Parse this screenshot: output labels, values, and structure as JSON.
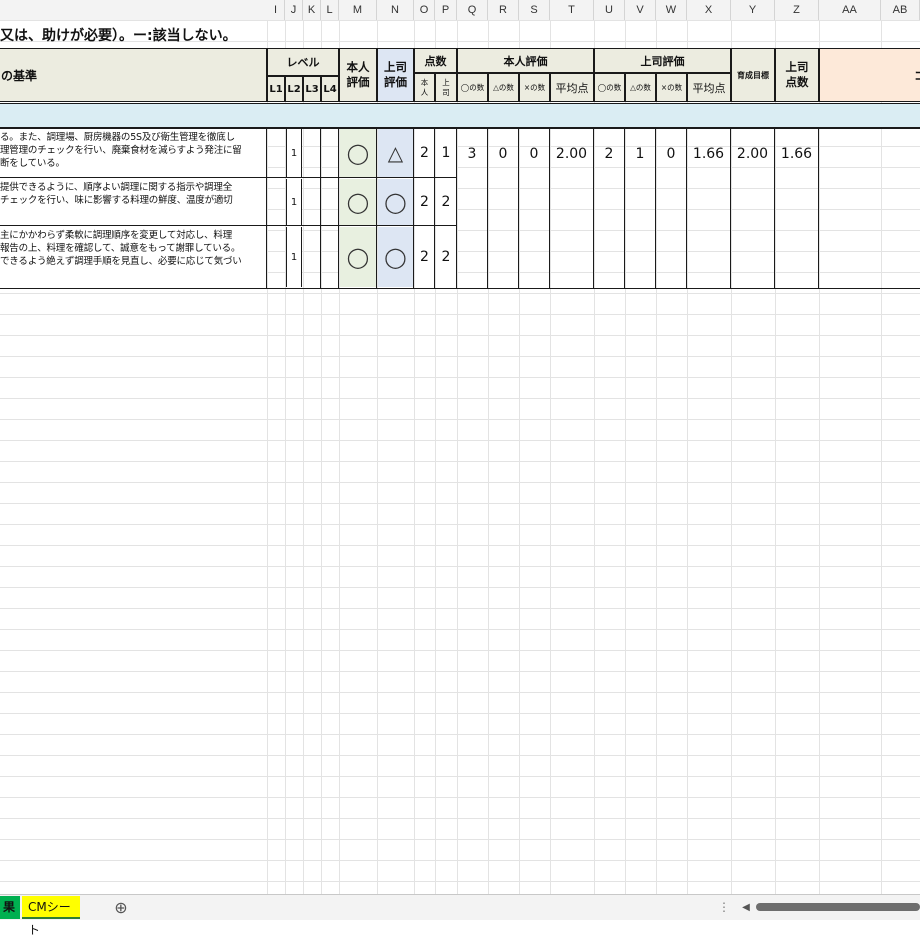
{
  "column_headers": [
    "I",
    "J",
    "K",
    "L",
    "M",
    "N",
    "O",
    "P",
    "Q",
    "R",
    "S",
    "T",
    "U",
    "V",
    "W",
    "X",
    "Y",
    "Z",
    "AA",
    "AB"
  ],
  "title_text": "又は、助けが必要）。ー:該当しない。",
  "headers": {
    "criteria": "の基準",
    "level": "レベル",
    "level_cols": [
      "L1",
      "L2",
      "L3",
      "L4"
    ],
    "self_eval": "本人評価",
    "boss_eval": "上司評価",
    "points": "点数",
    "points_self": "本人",
    "points_boss": "上司",
    "self_eval_group": "本人評価",
    "boss_eval_group": "上司評価",
    "circle_count": "◯の数",
    "triangle_count": "△の数",
    "cross_count": "×の数",
    "average": "平均点",
    "goal": "育成目標",
    "boss_points": "上司点数",
    "comment": "コ"
  },
  "rows": [
    {
      "criteria": "る。また、調理場、厨房機器の5S及び衛生管理を徹底し\n理管理のチェックを行い、廃棄食材を減らすよう発注に留\n断をしている。",
      "level": "1",
      "self_mark": "◯",
      "boss_mark": "△",
      "self_pt": "2",
      "boss_pt": "1"
    },
    {
      "criteria": "提供できるように、順序よい調理に関する指示や調理全\nチェックを行い、味に影響する料理の鮮度、温度が適切",
      "level": "1",
      "self_mark": "◯",
      "boss_mark": "◯",
      "self_pt": "2",
      "boss_pt": "2"
    },
    {
      "criteria": "主にかかわらず柔軟に調理順序を変更して対応し、料理\n報告の上、料理を確認して、誠意をもって謝罪している。\nできるよう絶えず調理手順を見直し、必要に応じて気づい",
      "level": "1",
      "self_mark": "◯",
      "boss_mark": "◯",
      "self_pt": "2",
      "boss_pt": "2"
    }
  ],
  "summary": {
    "self_circle": "3",
    "self_triangle": "0",
    "self_cross": "0",
    "self_avg": "2.00",
    "boss_circle": "2",
    "boss_triangle": "1",
    "boss_cross": "0",
    "boss_avg": "1.66",
    "goal": "2.00",
    "boss_points": "1.66"
  },
  "tabs": {
    "prev_tab": "果",
    "active_tab": "CMシート",
    "add_sheet": "⊕",
    "more": "⋮",
    "scroll_left": "◀"
  },
  "colors": {
    "header_bg": "#ecece0",
    "band_bg": "#daedf3",
    "self_col_bg": "#e8f0e0",
    "boss_col_bg": "#dde6f3",
    "comment_bg": "#fde9d9",
    "active_tab_bg": "#ffff00",
    "prev_tab_bg": "#00b050"
  }
}
